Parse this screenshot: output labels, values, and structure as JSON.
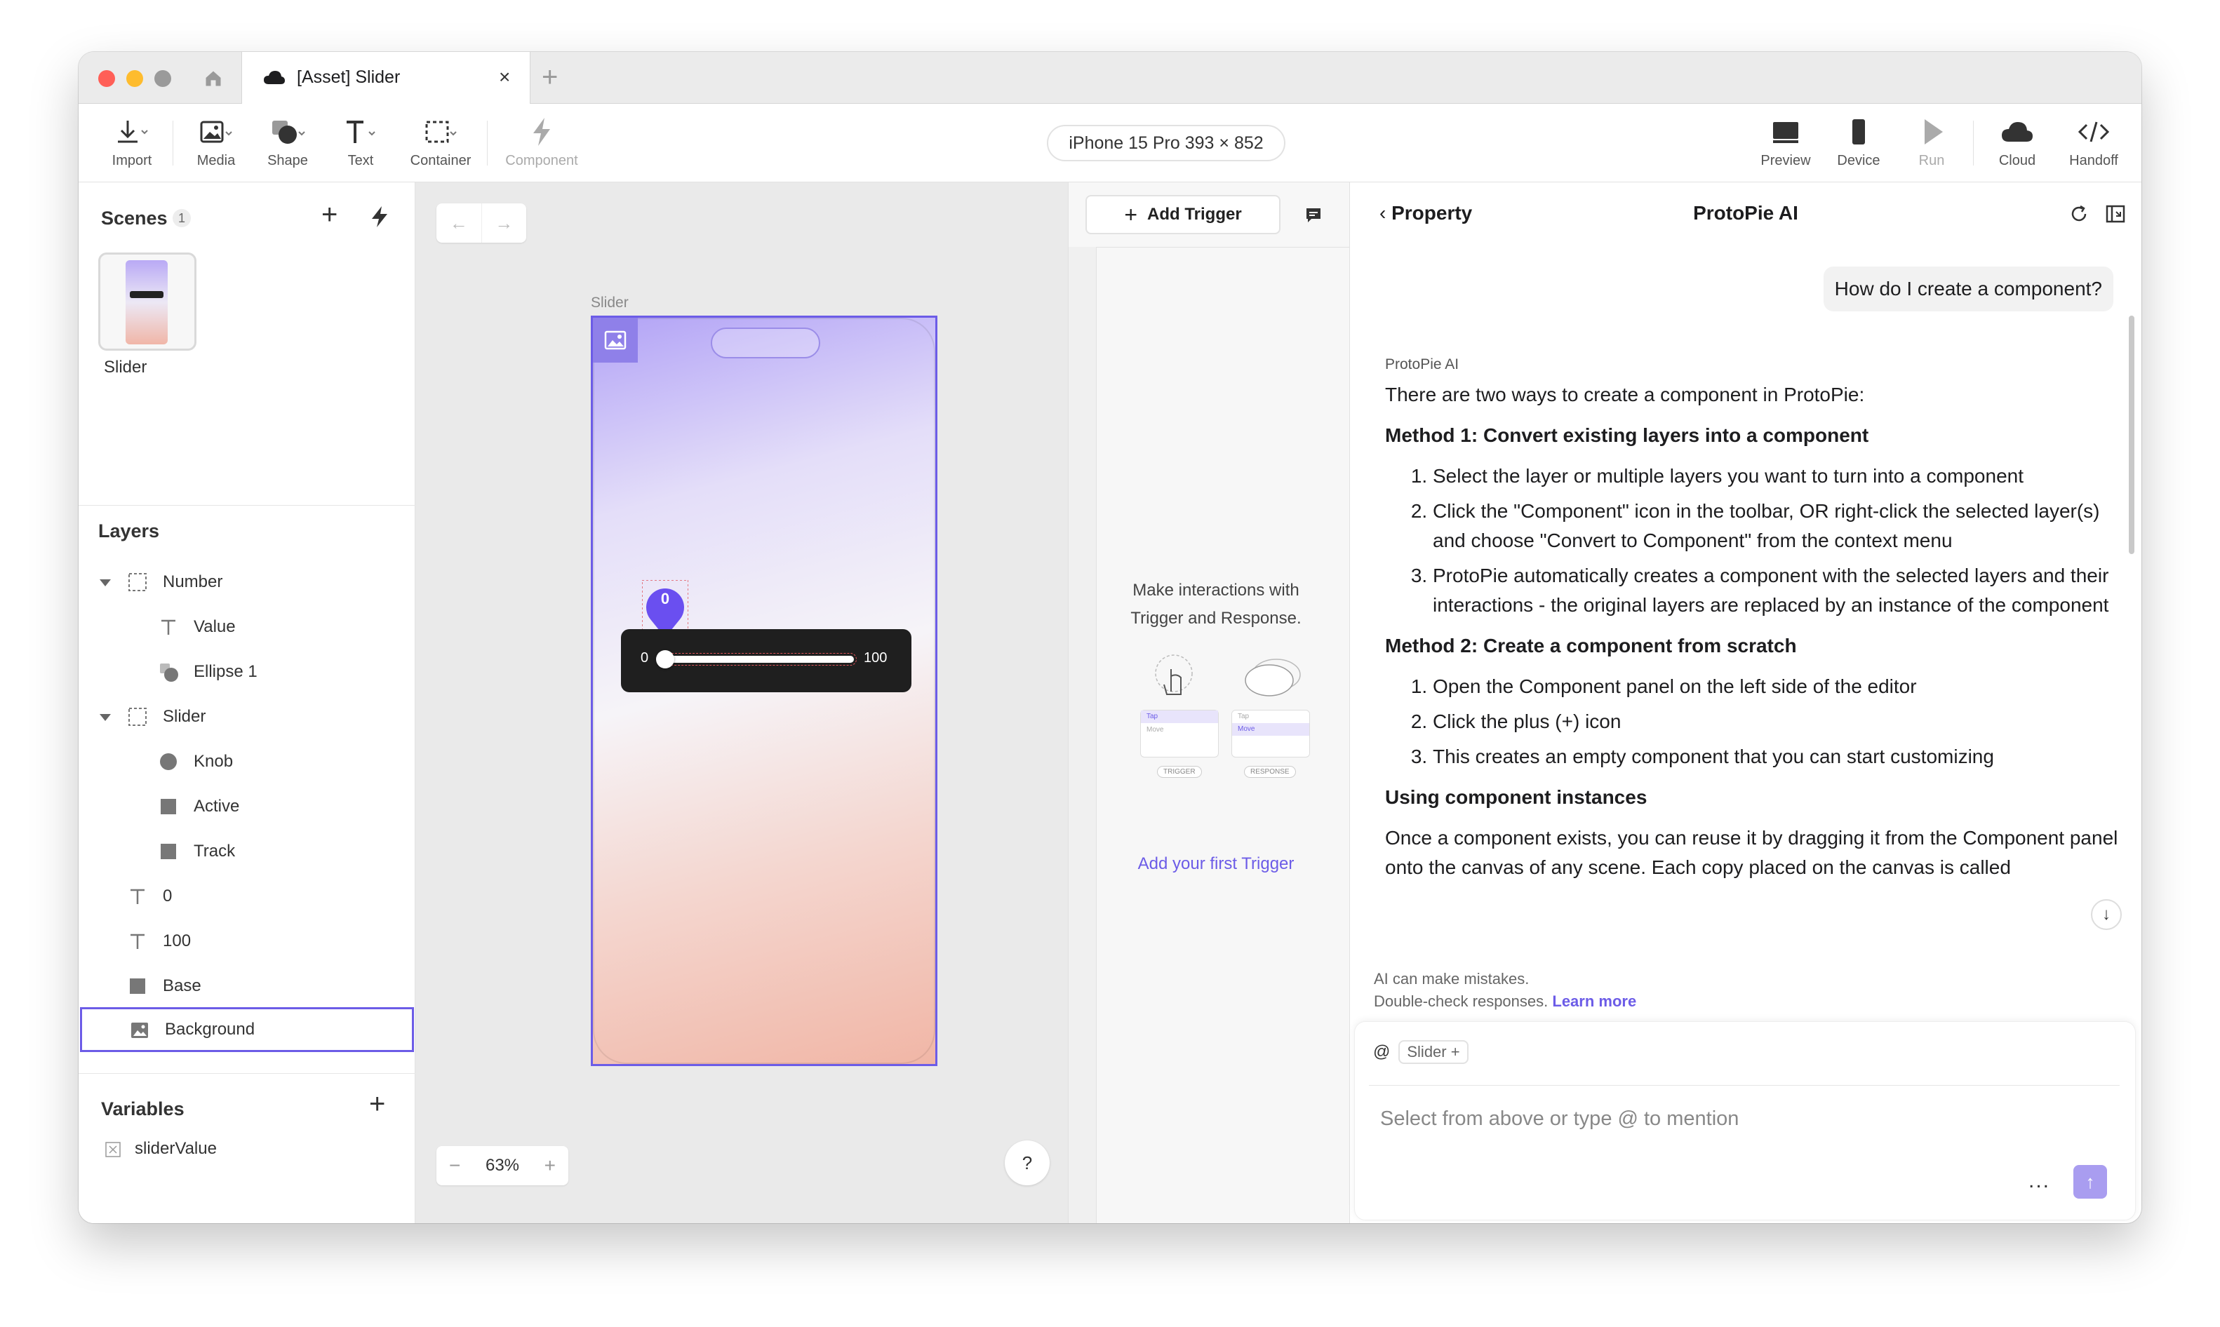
{
  "tab": {
    "title": "[Asset] Slider"
  },
  "toolbar": {
    "tools": [
      {
        "label": "Import",
        "icon": "import-icon"
      },
      {
        "label": "Media",
        "icon": "media-icon"
      },
      {
        "label": "Shape",
        "icon": "shape-icon"
      },
      {
        "label": "Text",
        "icon": "text-icon"
      },
      {
        "label": "Container",
        "icon": "container-icon"
      },
      {
        "label": "Component",
        "icon": "component-icon"
      }
    ],
    "device": "iPhone 15 Pro  393 × 852",
    "right_tools": [
      {
        "label": "Preview",
        "icon": "preview-icon"
      },
      {
        "label": "Device",
        "icon": "device-icon"
      },
      {
        "label": "Run",
        "icon": "run-icon"
      },
      {
        "label": "Cloud",
        "icon": "cloud-icon"
      },
      {
        "label": "Handoff",
        "icon": "handoff-icon"
      }
    ]
  },
  "scenes": {
    "title": "Scenes",
    "count": "1",
    "items": [
      {
        "label": "Slider"
      }
    ]
  },
  "layers": {
    "title": "Layers",
    "items": [
      {
        "name": "Number",
        "type": "container"
      },
      {
        "name": "Value",
        "type": "text"
      },
      {
        "name": "Ellipse 1",
        "type": "ellipse"
      },
      {
        "name": "Slider",
        "type": "container"
      },
      {
        "name": "Knob",
        "type": "ellipse"
      },
      {
        "name": "Active",
        "type": "rect"
      },
      {
        "name": "Track",
        "type": "rect"
      },
      {
        "name": "0",
        "type": "text"
      },
      {
        "name": "100",
        "type": "text"
      },
      {
        "name": "Base",
        "type": "rect"
      },
      {
        "name": "Background",
        "type": "image"
      }
    ]
  },
  "variables": {
    "title": "Variables",
    "items": [
      {
        "name": "sliderValue"
      }
    ]
  },
  "canvas": {
    "frame_label": "Slider",
    "knob_value": "0",
    "slider_min": "0",
    "slider_max": "100",
    "zoom": "63%",
    "help": "?"
  },
  "triggers": {
    "add_label": "Add Trigger",
    "empty_message": "Make interactions with Trigger and Response.",
    "first_link": "Add your first Trigger",
    "illus_trigger": "TRIGGER",
    "illus_response": "RESPONSE",
    "illus_tap": "Tap",
    "illus_move": "Move"
  },
  "ai": {
    "back_label": "Property",
    "title": "ProtoPie AI",
    "user_message": "How do I create a component?",
    "author": "ProtoPie AI",
    "intro": "There are two ways to create a component in ProtoPie:",
    "method1_title": "Method 1: Convert existing layers into a component",
    "method1_steps": [
      "Select the layer or multiple layers you want to turn into a component",
      "Click the \"Component\" icon in the toolbar, OR right-click the selected layer(s) and choose \"Convert to Component\" from the context menu",
      "ProtoPie automatically creates a component with the selected layers and their interactions - the original layers are replaced by an instance of the component"
    ],
    "method2_title": "Method 2: Create a component from scratch",
    "method2_steps": [
      "Open the Component panel on the left side of the editor",
      "Click the plus (+) icon",
      "This creates an empty component that you can start customizing"
    ],
    "instances_title": "Using component instances",
    "instances_text": "Once a component exists, you can reuse it by dragging it from the Component panel onto the canvas of any scene. Each copy placed on the canvas is called",
    "disclaimer_line1": "AI can make mistakes.",
    "disclaimer_line2": "Double-check responses.",
    "learn_more": "Learn more",
    "mention_at": "@",
    "mention_chip": "Slider +",
    "input_placeholder": "Select from above or type @ to mention",
    "more": "...",
    "accent": "#6c5ce7"
  }
}
